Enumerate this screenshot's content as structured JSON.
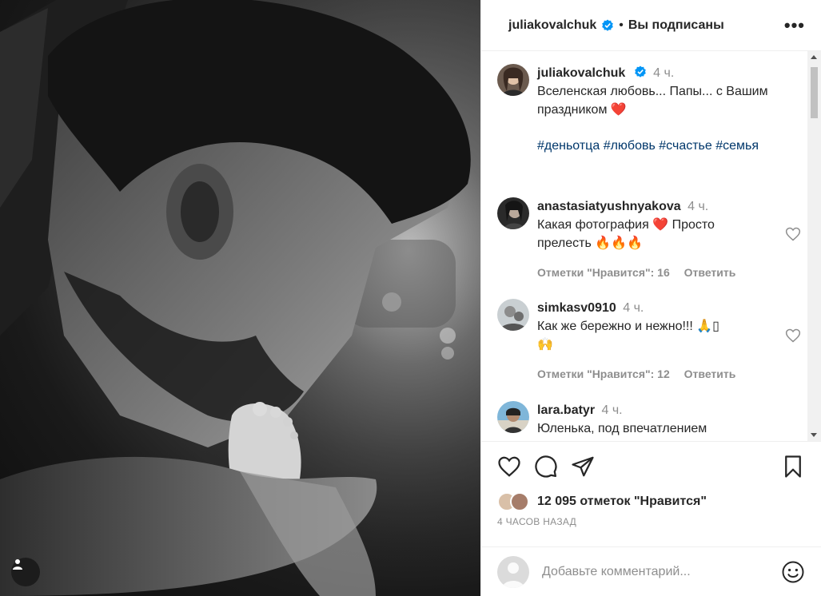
{
  "post": {
    "author": "juliakovalchuk",
    "follow_status": "Вы подписаны",
    "more_label": "•••",
    "caption": {
      "author": "juliakovalchuk",
      "time": "4 ч.",
      "text_line1": "Вселенская любовь... Папы... с Вашим",
      "text_line2": "праздником",
      "heart": "❤️",
      "hashtags": "#деньотца #любовь #счастье #семья"
    },
    "comments": [
      {
        "user": "anastasiatyushnyakova",
        "time": "4 ч.",
        "line1_a": "Какая фотография",
        "heart": "❤️",
        "line1_b": "Просто",
        "line2": "прелесть 🔥🔥🔥",
        "likes": "Отметки \"Нравится\": 16",
        "reply": "Ответить"
      },
      {
        "user": "simkasv0910",
        "time": "4 ч.",
        "line1": "Как же бережно и нежно!!! 🙏▯",
        "line2": "🙌",
        "likes": "Отметки \"Нравится\": 12",
        "reply": "Ответить"
      },
      {
        "user": "lara.batyr",
        "time": "4 ч.",
        "line1": "Юленька, под впечатлением"
      }
    ],
    "likes_count": "12 095 отметок \"Нравится\"",
    "time_ago": "4 ЧАСОВ НАЗАД",
    "comment_placeholder": "Добавьте комментарий..."
  },
  "colors": {
    "link": "#00376b",
    "muted": "#8e8e8e",
    "verified": "#0095f6",
    "heart": "#ed4956"
  },
  "icons": [
    "heart-icon",
    "comment-icon",
    "share-icon",
    "bookmark-icon",
    "emoji-icon",
    "user-tag-icon",
    "verified-icon",
    "more-icon"
  ]
}
